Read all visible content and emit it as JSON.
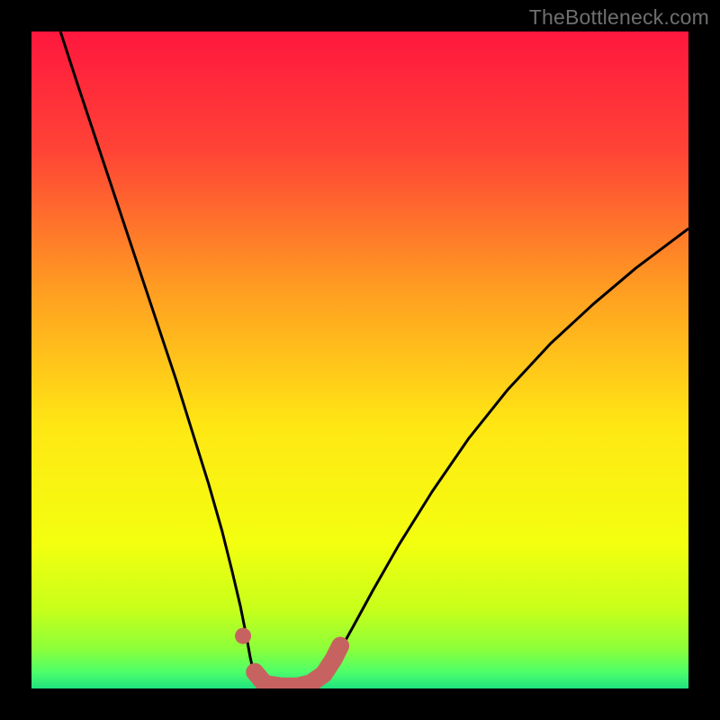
{
  "watermark": "TheBottleneck.com",
  "chart_data": {
    "type": "line",
    "title": "",
    "xlabel": "",
    "ylabel": "",
    "xlim": [
      0,
      1
    ],
    "ylim": [
      0,
      1
    ],
    "gradient_stops": [
      {
        "offset": 0.0,
        "color": "#ff173e"
      },
      {
        "offset": 0.18,
        "color": "#ff4336"
      },
      {
        "offset": 0.4,
        "color": "#ffa021"
      },
      {
        "offset": 0.6,
        "color": "#ffe714"
      },
      {
        "offset": 0.78,
        "color": "#f3ff0f"
      },
      {
        "offset": 0.88,
        "color": "#c7ff1a"
      },
      {
        "offset": 0.94,
        "color": "#8cff3a"
      },
      {
        "offset": 0.975,
        "color": "#4dff6a"
      },
      {
        "offset": 1.0,
        "color": "#20e27f"
      }
    ],
    "series": [
      {
        "name": "left-branch",
        "stroke": "#000000",
        "stroke_width": 3,
        "points": [
          {
            "x": 0.044,
            "y": 1.0
          },
          {
            "x": 0.07,
            "y": 0.92
          },
          {
            "x": 0.1,
            "y": 0.83
          },
          {
            "x": 0.13,
            "y": 0.74
          },
          {
            "x": 0.16,
            "y": 0.65
          },
          {
            "x": 0.19,
            "y": 0.56
          },
          {
            "x": 0.22,
            "y": 0.47
          },
          {
            "x": 0.245,
            "y": 0.39
          },
          {
            "x": 0.27,
            "y": 0.31
          },
          {
            "x": 0.29,
            "y": 0.24
          },
          {
            "x": 0.305,
            "y": 0.18
          },
          {
            "x": 0.318,
            "y": 0.125
          },
          {
            "x": 0.327,
            "y": 0.08
          },
          {
            "x": 0.333,
            "y": 0.047
          },
          {
            "x": 0.338,
            "y": 0.025
          },
          {
            "x": 0.343,
            "y": 0.012
          },
          {
            "x": 0.35,
            "y": 0.005
          }
        ]
      },
      {
        "name": "right-branch",
        "stroke": "#000000",
        "stroke_width": 3,
        "points": [
          {
            "x": 0.43,
            "y": 0.005
          },
          {
            "x": 0.445,
            "y": 0.02
          },
          {
            "x": 0.465,
            "y": 0.05
          },
          {
            "x": 0.49,
            "y": 0.095
          },
          {
            "x": 0.52,
            "y": 0.15
          },
          {
            "x": 0.56,
            "y": 0.22
          },
          {
            "x": 0.61,
            "y": 0.3
          },
          {
            "x": 0.665,
            "y": 0.38
          },
          {
            "x": 0.725,
            "y": 0.455
          },
          {
            "x": 0.79,
            "y": 0.525
          },
          {
            "x": 0.855,
            "y": 0.585
          },
          {
            "x": 0.92,
            "y": 0.64
          },
          {
            "x": 0.98,
            "y": 0.685
          },
          {
            "x": 1.0,
            "y": 0.7
          }
        ]
      },
      {
        "name": "bottom-highlight",
        "stroke": "#c66360",
        "stroke_width": 20,
        "linecap": "round",
        "points": [
          {
            "x": 0.34,
            "y": 0.025
          },
          {
            "x": 0.355,
            "y": 0.007
          },
          {
            "x": 0.38,
            "y": 0.003
          },
          {
            "x": 0.405,
            "y": 0.003
          },
          {
            "x": 0.425,
            "y": 0.008
          },
          {
            "x": 0.445,
            "y": 0.022
          },
          {
            "x": 0.46,
            "y": 0.045
          },
          {
            "x": 0.47,
            "y": 0.065
          }
        ]
      }
    ],
    "dots": [
      {
        "name": "left-dot",
        "x": 0.322,
        "y": 0.08,
        "r": 9,
        "fill": "#c66360"
      }
    ]
  }
}
